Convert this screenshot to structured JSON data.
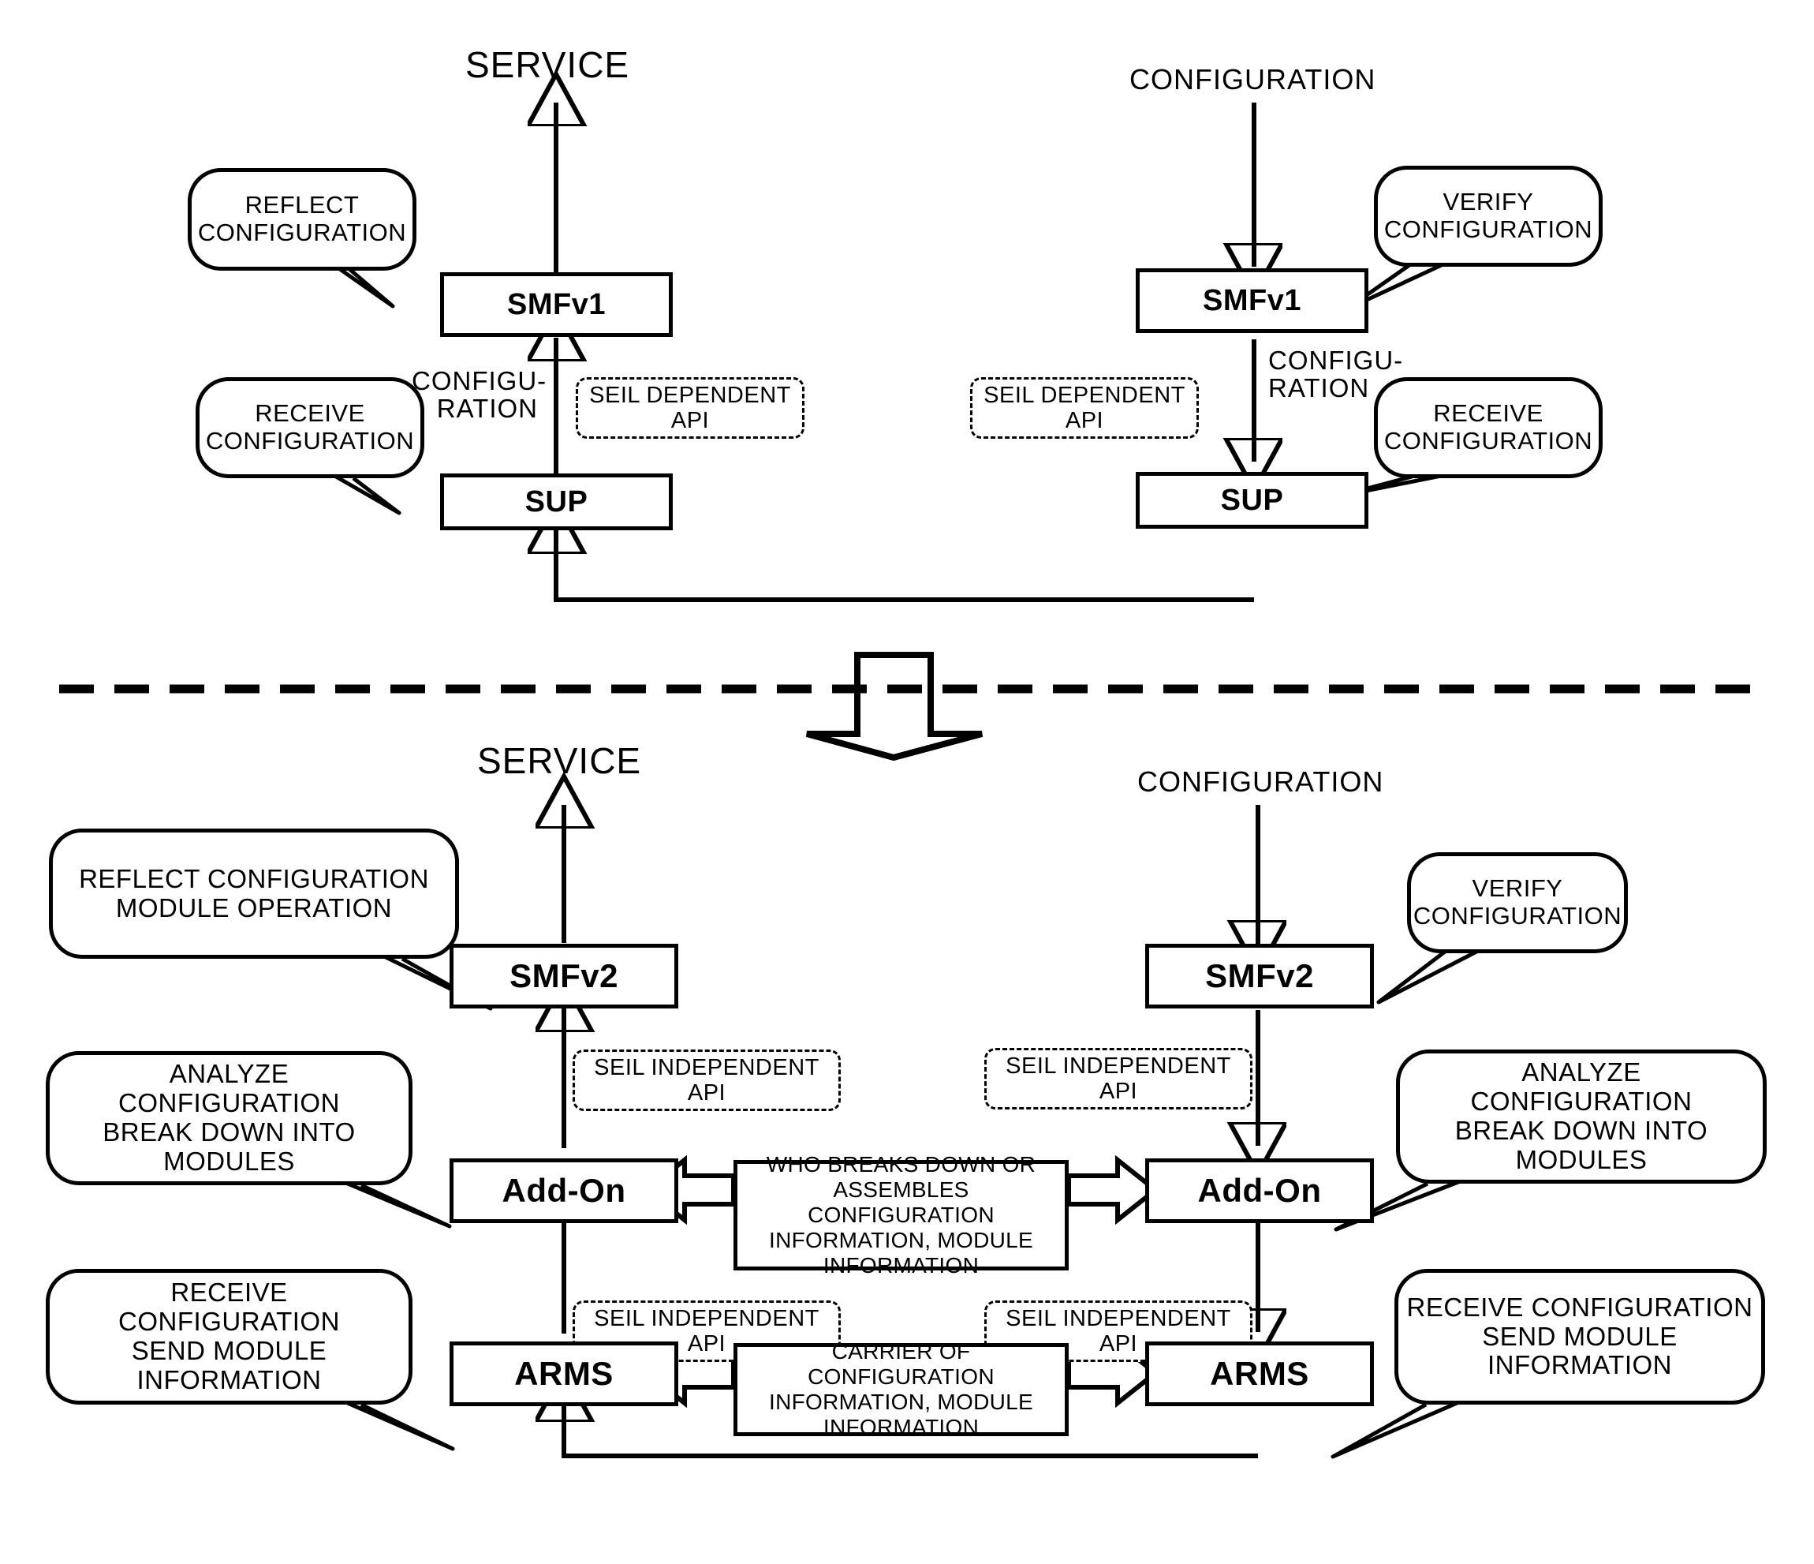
{
  "diagram": {
    "title_top_left": "SERVICE",
    "title_top_right": "CONFIGURATION",
    "title_bottom_left": "SERVICE",
    "title_bottom_right": "CONFIGURATION"
  },
  "top": {
    "labels": {
      "service": "SERVICE",
      "configuration": "CONFIGURATION",
      "config_left_l1": "CONFIGU-",
      "config_left_l2": "RATION",
      "config_right_l1": "CONFIGU-",
      "config_right_l2": "RATION"
    },
    "boxes": {
      "smf_left": "SMFv1",
      "smf_right": "SMFv1",
      "sup_left": "SUP",
      "sup_right": "SUP"
    },
    "api": {
      "left_l1": "SEIL DEPENDENT",
      "left_l2": "API",
      "right_l1": "SEIL DEPENDENT",
      "right_l2": "API"
    },
    "balloons": {
      "reflect_l1": "REFLECT",
      "reflect_l2": "CONFIGURATION",
      "verify_l1": "VERIFY",
      "verify_l2": "CONFIGURATION",
      "receive_left_l1": "RECEIVE",
      "receive_left_l2": "CONFIGURATION",
      "receive_right_l1": "RECEIVE",
      "receive_right_l2": "CONFIGURATION"
    }
  },
  "bottom": {
    "labels": {
      "service": "SERVICE",
      "configuration": "CONFIGURATION"
    },
    "boxes": {
      "smf_left": "SMFv2",
      "smf_right": "SMFv2",
      "addon_left": "Add-On",
      "addon_right": "Add-On",
      "arms_left": "ARMS",
      "arms_right": "ARMS"
    },
    "api": {
      "a_l1": "SEIL INDEPENDENT",
      "a_l2": "API",
      "b_l1": "SEIL INDEPENDENT",
      "b_l2": "API",
      "c_l1": "SEIL INDEPENDENT",
      "c_l2": "API",
      "d_l1": "SEIL INDEPENDENT",
      "d_l2": "API"
    },
    "infoboxes": {
      "addon_l1": "WHO BREAKS DOWN OR",
      "addon_l2": "ASSEMBLES CONFIGURATION",
      "addon_l3": "INFORMATION, MODULE",
      "addon_l4": "INFORMATION",
      "arms_l1": "CARRIER OF CONFIGURATION",
      "arms_l2": "INFORMATION, MODULE",
      "arms_l3": "INFORMATION"
    },
    "balloons": {
      "reflect_l1": "REFLECT CONFIGURATION",
      "reflect_l2": "MODULE OPERATION",
      "verify_l1": "VERIFY",
      "verify_l2": "CONFIGURATION",
      "analyze_left_l1": "ANALYZE CONFIGURATION",
      "analyze_left_l2": "BREAK DOWN INTO",
      "analyze_left_l3": "MODULES",
      "analyze_right_l1": "ANALYZE CONFIGURATION",
      "analyze_right_l2": "BREAK DOWN INTO",
      "analyze_right_l3": "MODULES",
      "receive_left_l1": "RECEIVE CONFIGURATION",
      "receive_left_l2": "SEND MODULE",
      "receive_left_l3": "INFORMATION",
      "receive_right_l1": "RECEIVE CONFIGURATION",
      "receive_right_l2": "SEND MODULE",
      "receive_right_l3": "INFORMATION"
    }
  },
  "colors": {
    "ink": "#000000",
    "paper": "#ffffff"
  }
}
